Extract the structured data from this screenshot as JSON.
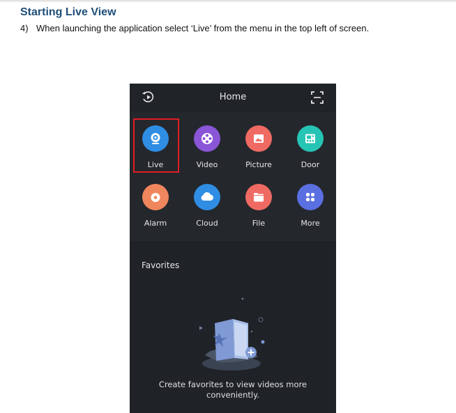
{
  "document": {
    "heading": "Starting Live View",
    "step_number": "4)",
    "step_text": "When launching the application select ‘Live’ from the menu in the top left of screen."
  },
  "app": {
    "header_title": "Home",
    "menu": [
      {
        "label": "Live",
        "icon": "camera-icon",
        "color": "#2f8de4",
        "selected": true
      },
      {
        "label": "Video",
        "icon": "film-reel-icon",
        "color": "#8a55d6"
      },
      {
        "label": "Picture",
        "icon": "image-icon",
        "color": "#ef6a62"
      },
      {
        "label": "Door",
        "icon": "door-panel-icon",
        "color": "#26c4b4"
      },
      {
        "label": "Alarm",
        "icon": "alarm-icon",
        "color": "#f0865e"
      },
      {
        "label": "Cloud",
        "icon": "cloud-icon",
        "color": "#2f8de4"
      },
      {
        "label": "File",
        "icon": "folder-icon",
        "color": "#ef6a62"
      },
      {
        "label": "More",
        "icon": "grid-dots-icon",
        "color": "#5a6fe0"
      }
    ],
    "favorites": {
      "title": "Favorites",
      "empty_message": "Create favorites to view videos more conveniently."
    }
  },
  "colors": {
    "heading": "#1f4e79",
    "highlight_box": "#e01e24",
    "phone_background": "#1f2227"
  }
}
